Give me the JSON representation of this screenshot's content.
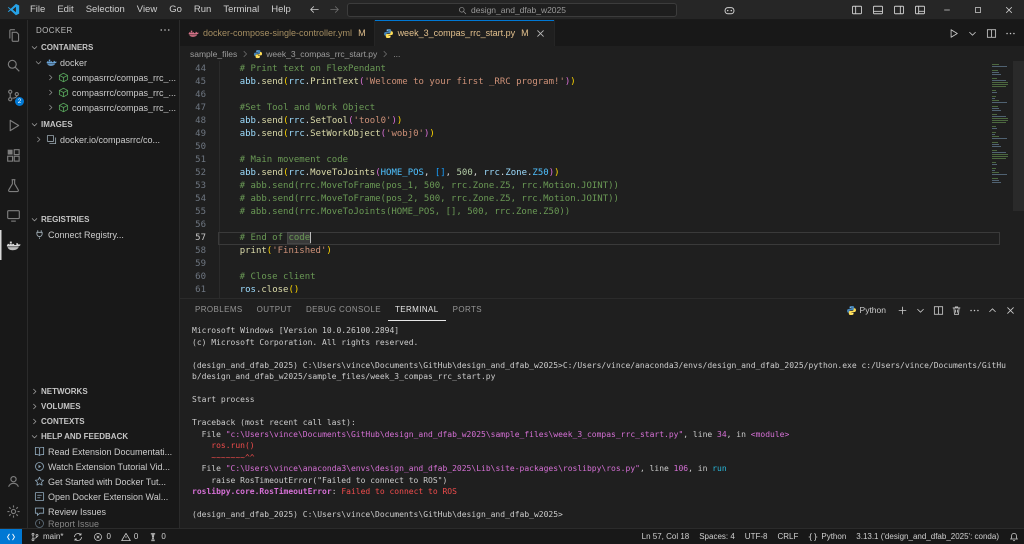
{
  "colors": {
    "accent": "#0078d4",
    "git_modified": "#e2c08d",
    "error": "#f14c4c",
    "comment": "#6a9955",
    "string": "#ce9178",
    "terminal_magenta": "#d670d6",
    "terminal_cyan": "#29b8db"
  },
  "title_bar": {
    "menus": [
      "File",
      "Edit",
      "Selection",
      "View",
      "Go",
      "Run",
      "Terminal",
      "Help"
    ],
    "command_center": "design_and_dfab_w2025",
    "layout_controls": [
      {
        "icon": "layout-sidebar",
        "name": "toggle-primary-sidebar"
      },
      {
        "icon": "layout-panel",
        "name": "toggle-panel"
      },
      {
        "icon": "layout-sidebar-right",
        "name": "toggle-secondary-sidebar"
      },
      {
        "icon": "layout-custom",
        "name": "customize-layout"
      }
    ],
    "window_controls": [
      {
        "icon": "minimize",
        "name": "minimize-button"
      },
      {
        "icon": "maximize",
        "name": "maximize-restore-button"
      },
      {
        "icon": "close-window",
        "name": "close-button"
      }
    ],
    "nav": [
      {
        "icon": "arrow-left",
        "name": "nav-back",
        "enabled": true
      },
      {
        "icon": "arrow-right",
        "name": "nav-forward",
        "enabled": false
      }
    ]
  },
  "activity_bar": {
    "items": [
      {
        "icon": "explorer",
        "name": "explorer"
      },
      {
        "icon": "search",
        "name": "search"
      },
      {
        "icon": "source-control",
        "name": "source-control",
        "badge": "2"
      },
      {
        "icon": "run-debug",
        "name": "run-and-debug"
      },
      {
        "icon": "extensions",
        "name": "extensions"
      },
      {
        "icon": "testing",
        "name": "testing"
      },
      {
        "icon": "remote-explorer",
        "name": "remote-explorer"
      },
      {
        "icon": "docker",
        "name": "docker",
        "active": true
      }
    ],
    "bottom_items": [
      {
        "icon": "account",
        "name": "accounts"
      },
      {
        "icon": "settings",
        "name": "manage"
      }
    ]
  },
  "sidebar": {
    "title": "DOCKER",
    "sections": [
      {
        "label": "CONTAINERS",
        "slug": "containers",
        "expanded": true,
        "items": [
          {
            "label": "docker",
            "icon": "docker-small",
            "level": 1,
            "expanded": true
          },
          {
            "label": "compasrrc/compas_rrc_...",
            "icon": "container",
            "level": 2,
            "chevron": true
          },
          {
            "label": "compasrrc/compas_rrc_...",
            "icon": "container",
            "level": 2,
            "chevron": true
          },
          {
            "label": "compasrrc/compas_rrc_...",
            "icon": "container",
            "level": 2,
            "chevron": true
          }
        ]
      },
      {
        "label": "IMAGES",
        "slug": "images",
        "expanded": true,
        "items": [
          {
            "label": "docker.io/compasrrc/co...",
            "icon": "image",
            "level": 1,
            "chevron": true
          }
        ]
      },
      {
        "label": "REGISTRIES",
        "slug": "registries",
        "expanded": true,
        "items": [
          {
            "label": "Connect Registry...",
            "icon": "plug",
            "level": 1
          }
        ]
      },
      {
        "label": "NETWORKS",
        "slug": "networks",
        "expanded": false,
        "items": []
      },
      {
        "label": "VOLUMES",
        "slug": "volumes",
        "expanded": false,
        "items": []
      },
      {
        "label": "CONTEXTS",
        "slug": "contexts",
        "expanded": false,
        "items": []
      },
      {
        "label": "HELP AND FEEDBACK",
        "slug": "help",
        "expanded": true,
        "items": [
          {
            "label": "Read Extension Documentati...",
            "icon": "book",
            "level": 1
          },
          {
            "label": "Watch Extension Tutorial Vid...",
            "icon": "play-circle",
            "level": 1
          },
          {
            "label": "Get Started with Docker Tut...",
            "icon": "star",
            "level": 1
          },
          {
            "label": "Open Docker Extension Wal...",
            "icon": "checklist",
            "level": 1
          },
          {
            "label": "Review Issues",
            "icon": "feedback",
            "level": 1
          },
          {
            "label": "Report Issue",
            "icon": "report",
            "level": 1,
            "clipped": true
          }
        ]
      }
    ]
  },
  "editor_tabs": {
    "tabs": [
      {
        "label": "docker-compose-single-controller.yml",
        "icon": "compose",
        "git": "M",
        "active": false
      },
      {
        "label": "week_3_compas_rrc_start.py",
        "icon": "python",
        "git": "M",
        "active": true,
        "close": true
      }
    ],
    "actions": [
      {
        "icon": "play",
        "name": "run-python-file"
      },
      {
        "icon": "chevron-down",
        "name": "run-dropdown"
      },
      {
        "icon": "split",
        "name": "split-editor"
      },
      {
        "icon": "more",
        "name": "more-editor-actions"
      }
    ]
  },
  "breadcrumb": {
    "items": [
      {
        "label": "sample_files"
      },
      {
        "label": "week_3_compas_rrc_start.py",
        "icon": "python"
      },
      {
        "label": "..."
      }
    ]
  },
  "editor": {
    "lines": [
      {
        "n": 44,
        "seg": [
          [
            "    # Print text on FlexPendant",
            "c"
          ]
        ]
      },
      {
        "n": 45,
        "seg": [
          [
            "    ",
            "d"
          ],
          [
            "abb",
            "v"
          ],
          [
            ".",
            "d"
          ],
          [
            "send",
            "f"
          ],
          [
            "(",
            "b1"
          ],
          [
            "rrc",
            "v"
          ],
          [
            ".",
            "d"
          ],
          [
            "PrintText",
            "f"
          ],
          [
            "(",
            "b2"
          ],
          [
            "'Welcome to your first _RRC program!'",
            "s"
          ],
          [
            ")",
            "b2"
          ],
          [
            ")",
            "b1"
          ]
        ]
      },
      {
        "n": 46,
        "seg": []
      },
      {
        "n": 47,
        "seg": [
          [
            "    #Set Tool and Work Object",
            "c"
          ]
        ]
      },
      {
        "n": 48,
        "seg": [
          [
            "    ",
            "d"
          ],
          [
            "abb",
            "v"
          ],
          [
            ".",
            "d"
          ],
          [
            "send",
            "f"
          ],
          [
            "(",
            "b1"
          ],
          [
            "rrc",
            "v"
          ],
          [
            ".",
            "d"
          ],
          [
            "SetTool",
            "f"
          ],
          [
            "(",
            "b2"
          ],
          [
            "'tool0'",
            "s"
          ],
          [
            ")",
            "b2"
          ],
          [
            ")",
            "b1"
          ]
        ]
      },
      {
        "n": 49,
        "seg": [
          [
            "    ",
            "d"
          ],
          [
            "abb",
            "v"
          ],
          [
            ".",
            "d"
          ],
          [
            "send",
            "f"
          ],
          [
            "(",
            "b1"
          ],
          [
            "rrc",
            "v"
          ],
          [
            ".",
            "d"
          ],
          [
            "SetWorkObject",
            "f"
          ],
          [
            "(",
            "b2"
          ],
          [
            "'wobj0'",
            "s"
          ],
          [
            ")",
            "b2"
          ],
          [
            ")",
            "b1"
          ]
        ]
      },
      {
        "n": 50,
        "seg": []
      },
      {
        "n": 51,
        "seg": [
          [
            "    # Main movement code",
            "c"
          ]
        ]
      },
      {
        "n": 52,
        "seg": [
          [
            "    ",
            "d"
          ],
          [
            "abb",
            "v"
          ],
          [
            ".",
            "d"
          ],
          [
            "send",
            "f"
          ],
          [
            "(",
            "b1"
          ],
          [
            "rrc",
            "v"
          ],
          [
            ".",
            "d"
          ],
          [
            "MoveToJoints",
            "f"
          ],
          [
            "(",
            "b2"
          ],
          [
            "HOME_POS",
            "k"
          ],
          [
            ", ",
            "d"
          ],
          [
            "[]",
            "b3"
          ],
          [
            ", ",
            "d"
          ],
          [
            "500",
            "n"
          ],
          [
            ", ",
            "d"
          ],
          [
            "rrc",
            "v"
          ],
          [
            ".",
            "d"
          ],
          [
            "Zone",
            "v"
          ],
          [
            ".",
            "d"
          ],
          [
            "Z50",
            "k"
          ],
          [
            ")",
            "b2"
          ],
          [
            ")",
            "b1"
          ]
        ]
      },
      {
        "n": 53,
        "seg": [
          [
            "    # abb.send(rrc.MoveToFrame(pos_1, 500, rrc.Zone.Z5, rrc.Motion.JOINT))",
            "c"
          ]
        ]
      },
      {
        "n": 54,
        "seg": [
          [
            "    # abb.send(rrc.MoveToFrame(pos_2, 500, rrc.Zone.Z5, rrc.Motion.JOINT))",
            "c"
          ]
        ]
      },
      {
        "n": 55,
        "seg": [
          [
            "    # abb.send(rrc.MoveToJoints(HOME_POS, [], 500, rrc.Zone.Z50))",
            "c"
          ]
        ]
      },
      {
        "n": 56,
        "seg": []
      },
      {
        "n": 57,
        "current": true,
        "seg": [
          [
            "    # End of ",
            "c"
          ],
          [
            "code",
            "c hl"
          ],
          [
            "",
            "cursor"
          ]
        ]
      },
      {
        "n": 58,
        "seg": [
          [
            "    ",
            "d"
          ],
          [
            "print",
            "f"
          ],
          [
            "(",
            "b1"
          ],
          [
            "'Finished'",
            "s"
          ],
          [
            ")",
            "b1"
          ]
        ]
      },
      {
        "n": 59,
        "seg": []
      },
      {
        "n": 60,
        "seg": [
          [
            "    # Close client",
            "c"
          ]
        ]
      },
      {
        "n": 61,
        "seg": [
          [
            "    ",
            "d"
          ],
          [
            "ros",
            "v"
          ],
          [
            ".",
            "d"
          ],
          [
            "close",
            "f"
          ],
          [
            "()",
            "b1"
          ]
        ]
      }
    ]
  },
  "panel": {
    "tabs": [
      {
        "label": "PROBLEMS"
      },
      {
        "label": "OUTPUT"
      },
      {
        "label": "DEBUG CONSOLE"
      },
      {
        "label": "TERMINAL",
        "active": true
      },
      {
        "label": "PORTS"
      }
    ],
    "profile": {
      "icon": "python",
      "label": "Python"
    },
    "actions": [
      {
        "icon": "plus",
        "name": "new-terminal"
      },
      {
        "icon": "chevron-down",
        "name": "terminal-profile-dropdown"
      },
      {
        "icon": "split",
        "name": "split-terminal"
      },
      {
        "icon": "trash",
        "name": "kill-terminal"
      },
      {
        "icon": "more",
        "name": "more-terminal-actions"
      },
      {
        "icon": "chevron-up",
        "name": "maximize-panel"
      },
      {
        "icon": "close",
        "name": "close-panel"
      }
    ]
  },
  "terminal": {
    "lines": [
      {
        "seg": [
          [
            "Microsoft Windows [Version 10.0.26100.2894]",
            "t"
          ]
        ]
      },
      {
        "seg": [
          [
            "(c) Microsoft Corporation. All rights reserved.",
            "t"
          ]
        ]
      },
      {
        "seg": []
      },
      {
        "seg": [
          [
            "(design_and_dfab_2025) C:\\Users\\vince\\Documents\\GitHub\\design_and_dfab_w2025>C:/Users/vince/anaconda3/envs/design_and_dfab_2025/python.exe c:/Users/vince/Documents/GitHub/design_and_dfab_w2025/sample_files/week_3_compas_rrc_start.py",
            "t"
          ]
        ]
      },
      {
        "seg": []
      },
      {
        "seg": [
          [
            "Start process",
            "t"
          ]
        ]
      },
      {
        "seg": []
      },
      {
        "seg": [
          [
            "Traceback (most recent call last):",
            "t"
          ]
        ]
      },
      {
        "seg": [
          [
            "  File ",
            "t"
          ],
          [
            "\"c:\\Users\\vince\\Documents\\GitHub\\design_and_dfab_w2025\\sample_files\\week_3_compas_rrc_start.py\"",
            "m"
          ],
          [
            ", line ",
            "t"
          ],
          [
            "34",
            "m"
          ],
          [
            ", in ",
            "t"
          ],
          [
            "<module>",
            "m"
          ]
        ]
      },
      {
        "seg": [
          [
            "    ",
            "t"
          ],
          [
            "ros.run()",
            "r"
          ]
        ]
      },
      {
        "seg": [
          [
            "    ",
            "t"
          ],
          [
            "~~~~~~~^^",
            "r"
          ]
        ]
      },
      {
        "seg": [
          [
            "  File ",
            "t"
          ],
          [
            "\"C:\\Users\\vince\\anaconda3\\envs\\design_and_dfab_2025\\Lib\\site-packages\\roslibpy\\ros.py\"",
            "m"
          ],
          [
            ", line ",
            "t"
          ],
          [
            "106",
            "m"
          ],
          [
            ", in ",
            "t"
          ],
          [
            "run",
            "c"
          ]
        ]
      },
      {
        "seg": [
          [
            "    raise RosTimeoutError(\"Failed to connect to ROS\")",
            "t"
          ]
        ]
      },
      {
        "seg": [
          [
            "roslibpy.core.RosTimeoutError",
            "mb"
          ],
          [
            ": ",
            "t"
          ],
          [
            "Failed to connect to ROS",
            "r"
          ]
        ]
      },
      {
        "seg": []
      },
      {
        "seg": [
          [
            "(design_and_dfab_2025) C:\\Users\\vince\\Documents\\GitHub\\design_and_dfab_w2025>",
            "t"
          ]
        ]
      }
    ]
  },
  "status_bar": {
    "left": [
      {
        "name": "remote",
        "icon": "remote-indicator",
        "label": "",
        "accent": true
      },
      {
        "name": "branch",
        "icon": "branch",
        "label": "main*"
      },
      {
        "name": "sync-changes",
        "icon": "sync",
        "label": ""
      },
      {
        "name": "errors",
        "icon": "error",
        "label": "0"
      },
      {
        "name": "warnings",
        "icon": "warning",
        "label": "0"
      },
      {
        "name": "broadcast",
        "icon": "radio-tower",
        "label": "0"
      }
    ],
    "right": [
      {
        "name": "cursor-position",
        "label": "Ln 57, Col 18"
      },
      {
        "name": "indentation",
        "label": "Spaces: 4"
      },
      {
        "name": "encoding",
        "label": "UTF-8"
      },
      {
        "name": "eol",
        "label": "CRLF"
      },
      {
        "name": "language-mode",
        "icon": "braces",
        "label": "Python"
      },
      {
        "name": "python-interpreter",
        "label": "3.13.1 ('design_and_dfab_2025': conda)"
      },
      {
        "name": "notifications",
        "icon": "bell",
        "label": ""
      }
    ]
  }
}
